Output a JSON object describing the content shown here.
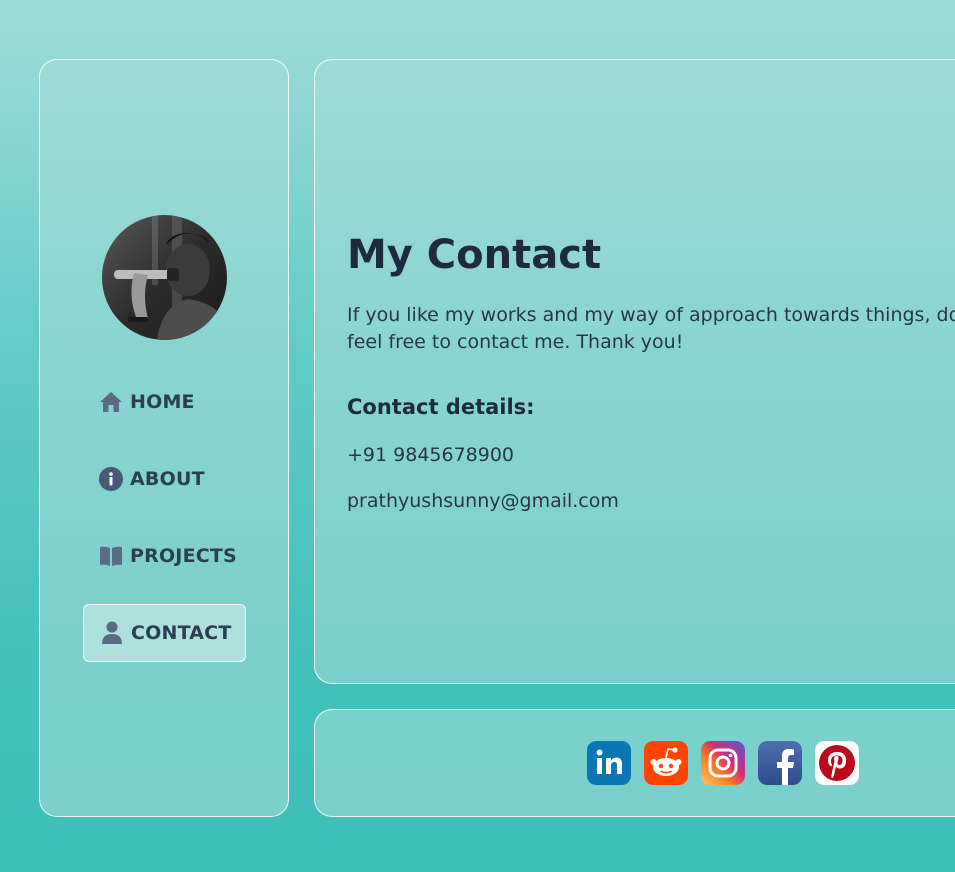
{
  "sidebar": {
    "avatar_alt": "profile photo",
    "nav": [
      {
        "label": "HOME",
        "icon": "home-icon"
      },
      {
        "label": "ABOUT",
        "icon": "info-icon"
      },
      {
        "label": "PROJECTS",
        "icon": "book-icon"
      },
      {
        "label": "CONTACT",
        "icon": "user-icon",
        "active": true
      }
    ]
  },
  "main": {
    "title": "My Contact",
    "intro": "If you like my works and my way of approach towards things, do feel free to contact me. Thank you!",
    "details_heading": "Contact details:",
    "phone": "+91 9845678900",
    "email": "prathyushsunny@gmail.com"
  },
  "footer": {
    "social": [
      {
        "name": "linkedin-icon",
        "color": "#0a77b5"
      },
      {
        "name": "reddit-icon",
        "color": "#ff4500"
      },
      {
        "name": "instagram-icon",
        "color": "#c13584"
      },
      {
        "name": "facebook-icon",
        "color": "#3b5998"
      },
      {
        "name": "pinterest-icon",
        "color": "#bd081c"
      }
    ]
  },
  "colors": {
    "text_dark": "#1e2a40",
    "nav_icon": "#5b6b86"
  }
}
